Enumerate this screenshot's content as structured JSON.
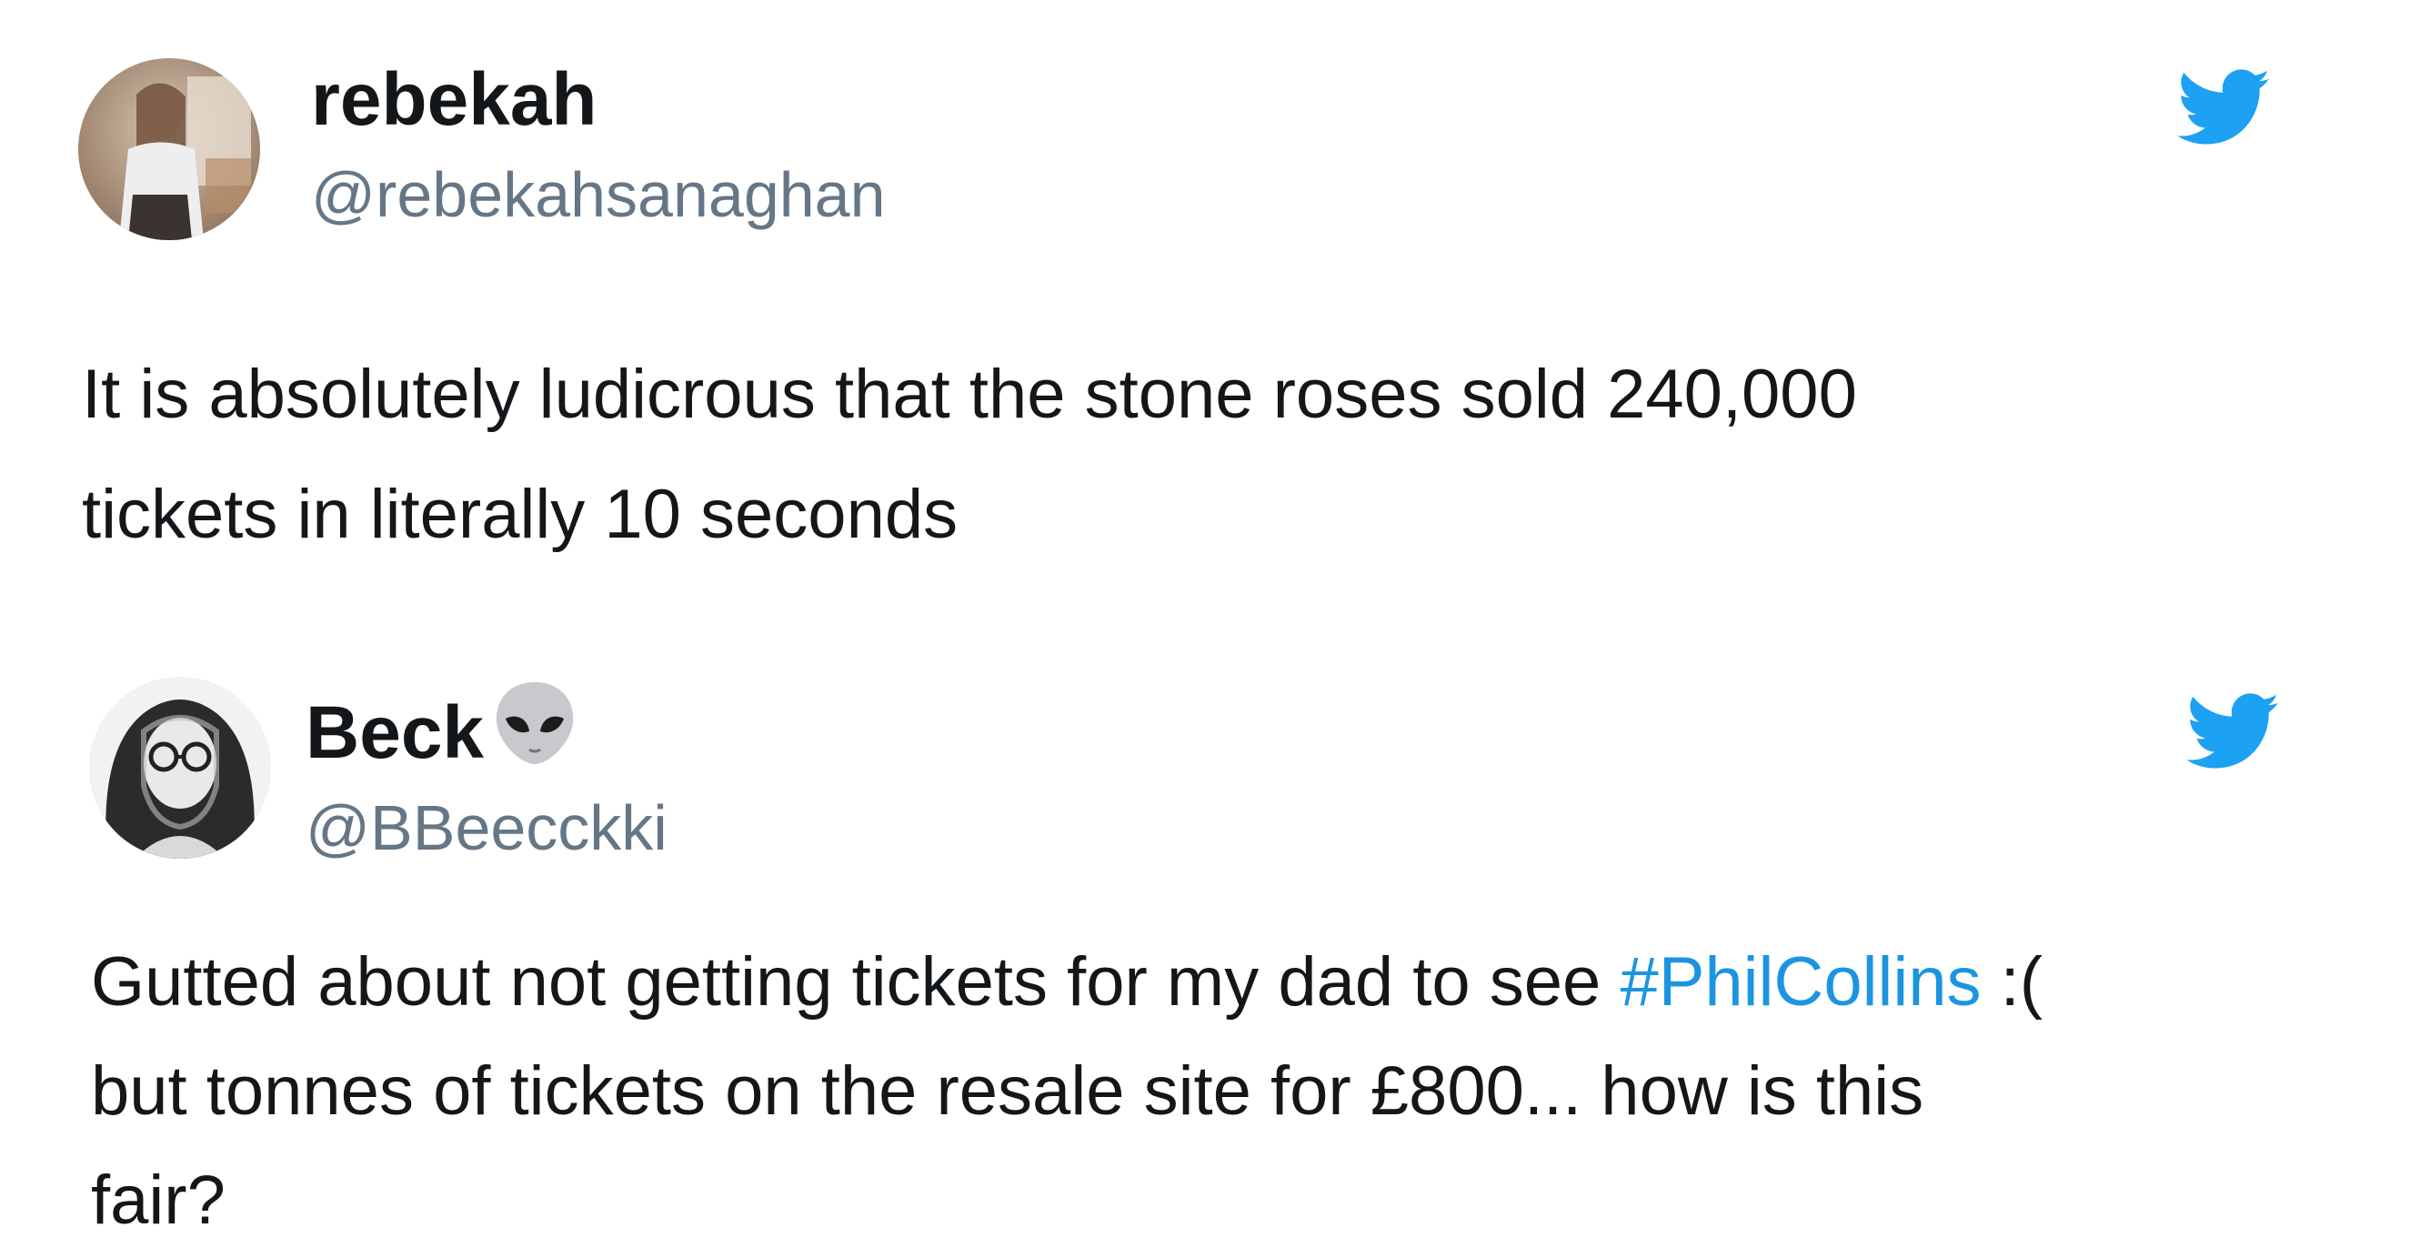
{
  "tweets": [
    {
      "display_name": "rebekah",
      "handle": "@rebekahsanaghan",
      "text_lines": [
        "It is absolutely ludicrous that the stone roses sold 240,000",
        "tickets in literally 10 seconds"
      ],
      "icon": "twitter-bird-icon"
    },
    {
      "display_name": "Beck",
      "name_emoji": "alien-icon",
      "handle": "@BBeecckki",
      "text_line1_before": "Gutted about not getting tickets for my dad to see ",
      "hashtag": "#PhilCollins",
      "text_line1_after": " :(",
      "text_line2": "but tonnes of tickets on the resale site for £800... how is this",
      "text_line3": "fair?",
      "icon": "twitter-bird-icon"
    }
  ],
  "colors": {
    "name": "#14171a",
    "handle": "#657786",
    "hashtag": "#1b95e0",
    "twitter_blue": "#1da1f2"
  }
}
